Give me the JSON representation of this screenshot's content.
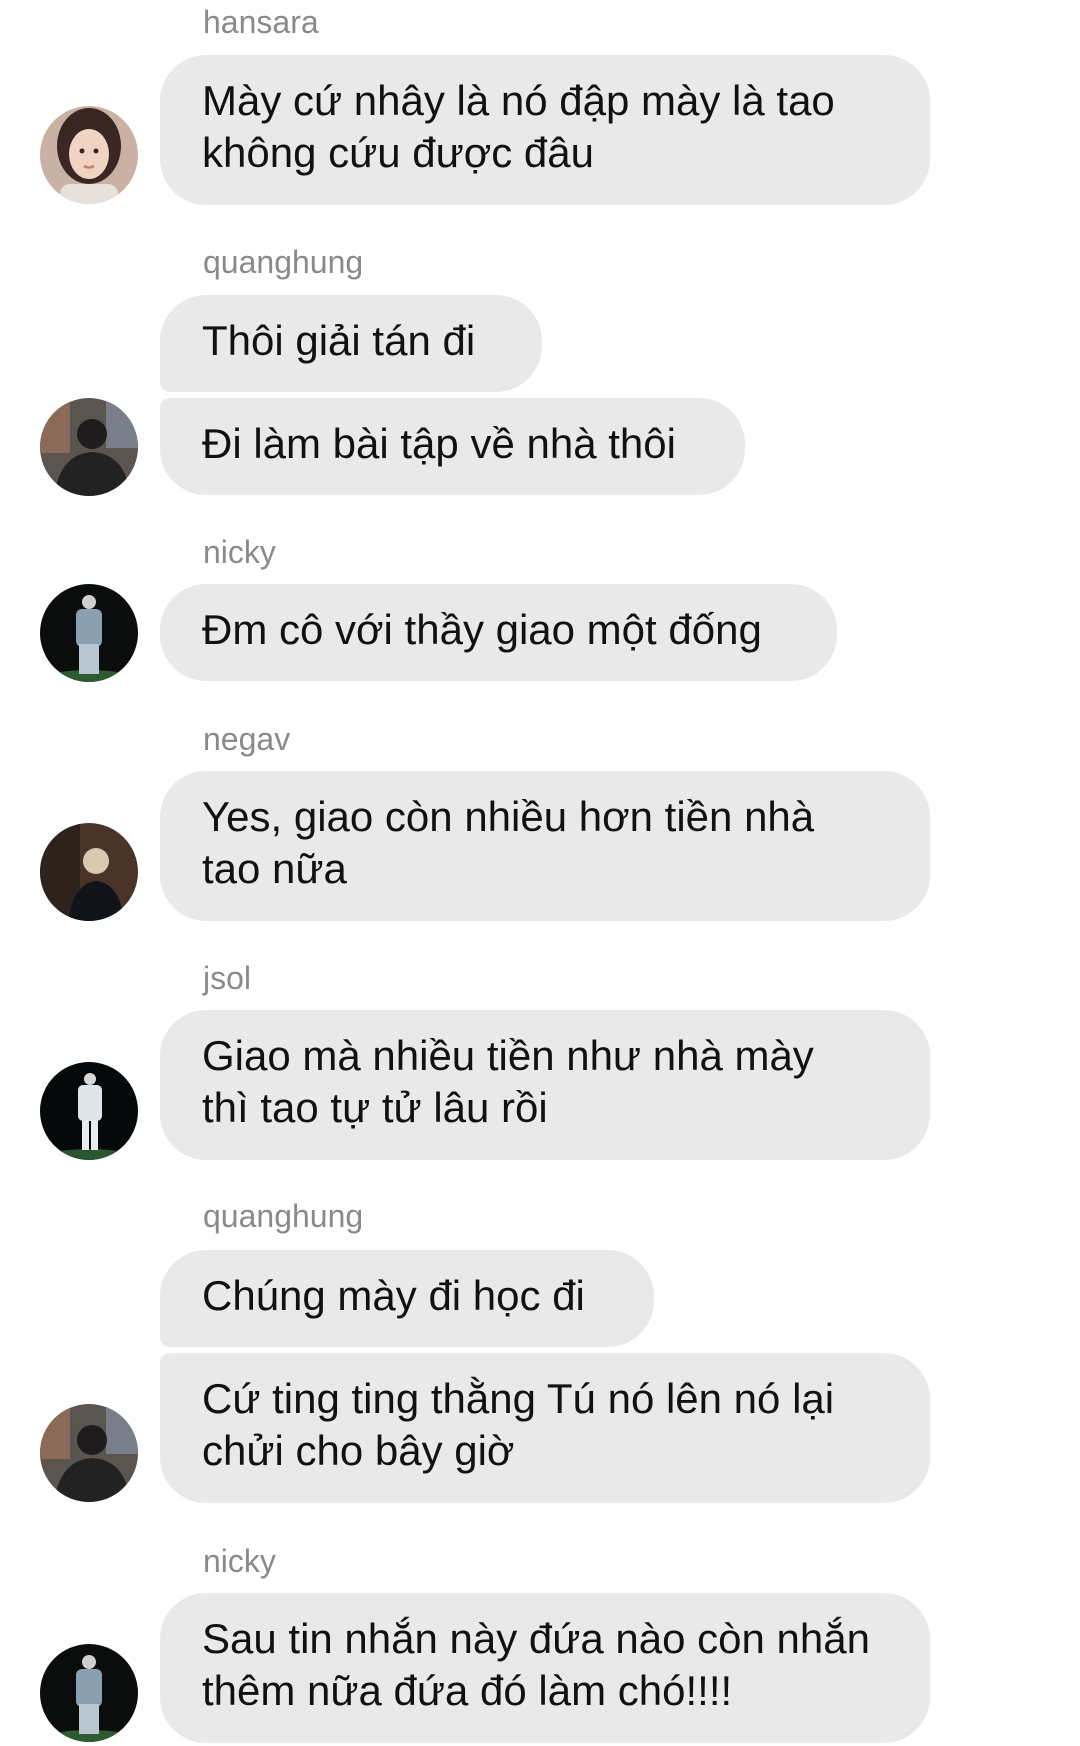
{
  "conversation": {
    "groups": [
      {
        "sender": "hansara",
        "avatar_icon": "user-avatar-hansara-icon",
        "messages": [
          "Mày cứ nhây là nó đập mày là tao\nkhông cứu được đâu"
        ]
      },
      {
        "sender": "quanghung",
        "avatar_icon": "user-avatar-quanghung-icon",
        "messages": [
          "Thôi giải tán đi",
          "Đi làm bài tập về nhà thôi"
        ]
      },
      {
        "sender": "nicky",
        "avatar_icon": "user-avatar-nicky-icon",
        "messages": [
          "Đm cô với thầy giao một đống"
        ]
      },
      {
        "sender": "negav",
        "avatar_icon": "user-avatar-negav-icon",
        "messages": [
          "Yes, giao còn nhiều hơn tiền nhà\ntao nữa"
        ]
      },
      {
        "sender": "jsol",
        "avatar_icon": "user-avatar-jsol-icon",
        "messages": [
          "Giao mà nhiều tiền như nhà mày\nthì tao tự tử lâu rồi"
        ]
      },
      {
        "sender": "quanghung",
        "avatar_icon": "user-avatar-quanghung-icon",
        "messages": [
          "Chúng mày đi học đi",
          "Cứ ting ting thằng Tú nó lên nó lại\nchửi cho bây giờ"
        ]
      },
      {
        "sender": "nicky",
        "avatar_icon": "user-avatar-nicky-icon",
        "messages": [
          "Sau tin nhắn này đứa nào còn nhắn\nthêm nữa đứa đó làm chó!!!!"
        ]
      }
    ]
  },
  "colors": {
    "bubble_bg": "#e9e9e9",
    "sender_name": "#8a8a8a",
    "message_text": "#111111",
    "page_bg": "#ffffff"
  }
}
